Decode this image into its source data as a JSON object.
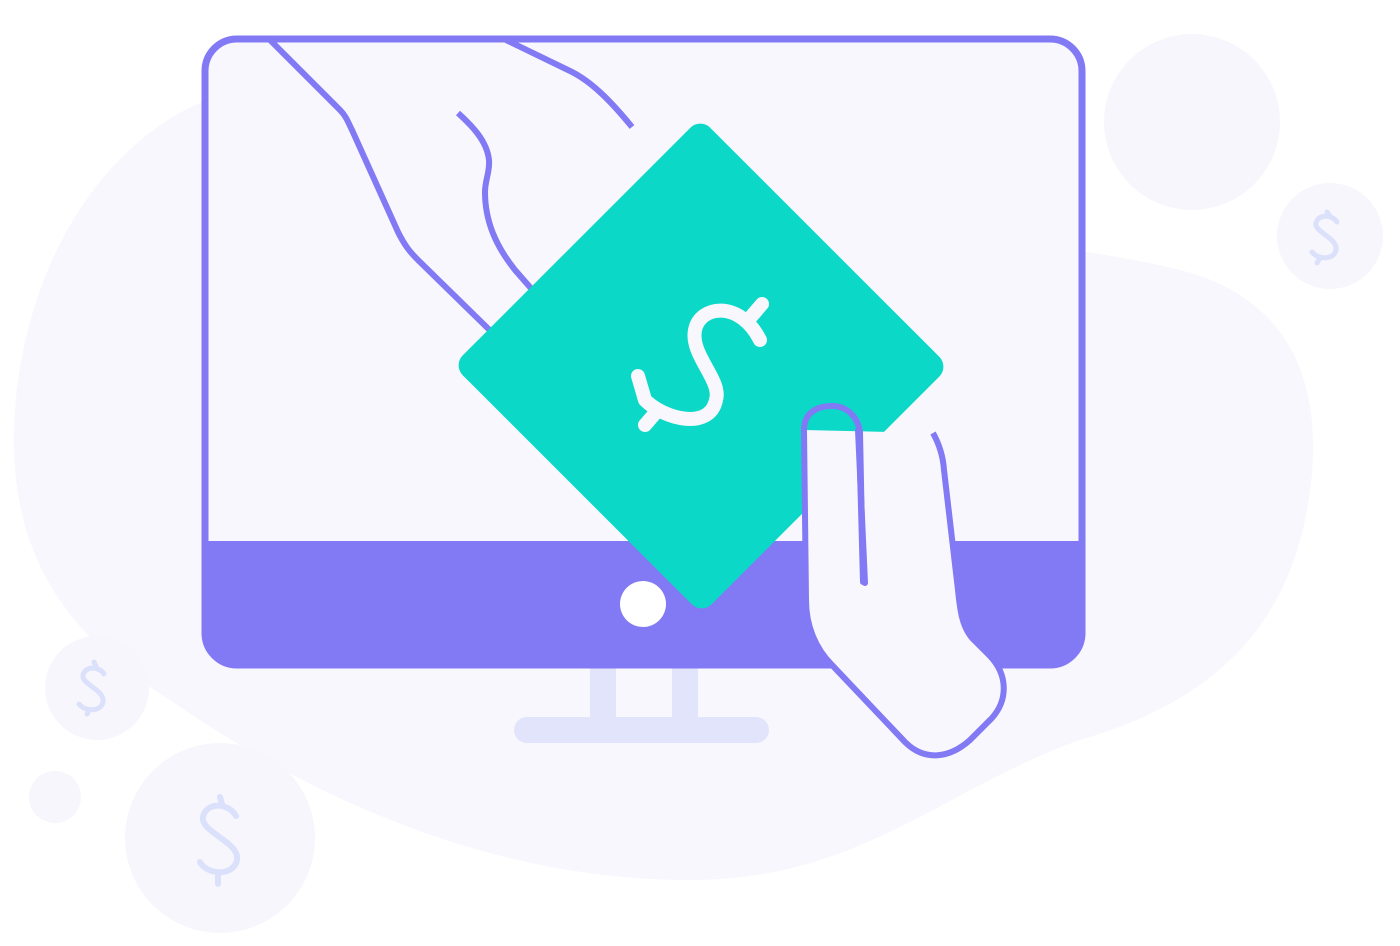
{
  "illustration": {
    "subject": "online-money-transfer",
    "icons": [
      "monitor-icon",
      "banknote-icon",
      "hand-icon",
      "dollar-coin-icon"
    ]
  },
  "colors": {
    "outline": "#8279F4",
    "screen": "#F8F7FD",
    "blob": "#F8F7FD",
    "note": "#0CD8C8",
    "note_symbol": "#F8F7FD",
    "stand": "#E2E4FB",
    "coin": "#F7F6FC",
    "coin_symbol": "#DCE1FB",
    "bezel_button": "#FFFFFF"
  }
}
